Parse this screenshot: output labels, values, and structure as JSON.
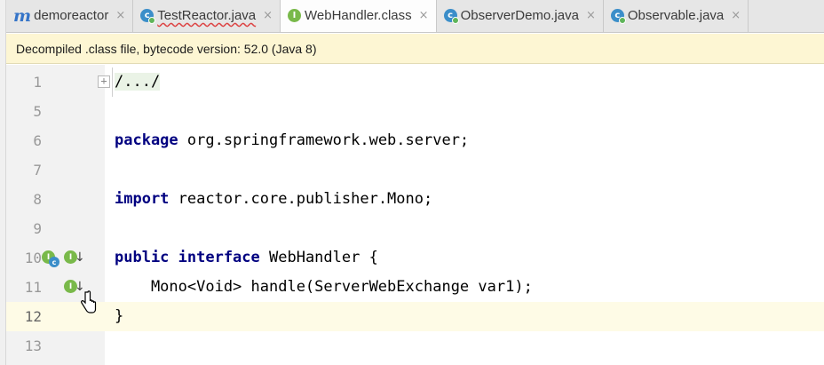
{
  "tabs": [
    {
      "label": "demoreactor",
      "icon": "module-icon",
      "active": false
    },
    {
      "label": "TestReactor.java",
      "icon": "class-icon",
      "active": false
    },
    {
      "label": "WebHandler.class",
      "icon": "interface-icon",
      "active": true
    },
    {
      "label": "ObserverDemo.java",
      "icon": "class-icon",
      "active": false
    },
    {
      "label": "Observable.java",
      "icon": "class-icon",
      "active": false
    }
  ],
  "close_glyph": "×",
  "banner": {
    "text": "Decompiled .class file, bytecode version: 52.0 (Java 8)"
  },
  "editor": {
    "lines": [
      {
        "num": "1",
        "code": "/.../"
      },
      {
        "num": "5",
        "code": ""
      },
      {
        "num": "6",
        "kw": "package",
        "rest": " org.springframework.web.server;"
      },
      {
        "num": "7",
        "code": ""
      },
      {
        "num": "8",
        "kw": "import",
        "rest": " reactor.core.publisher.Mono;"
      },
      {
        "num": "9",
        "code": ""
      },
      {
        "num": "10",
        "kw": "public interface",
        "rest": " WebHandler {"
      },
      {
        "num": "11",
        "code": "    Mono<Void> handle(ServerWebExchange var1);"
      },
      {
        "num": "12",
        "code": "}"
      },
      {
        "num": "13",
        "code": ""
      }
    ],
    "fold_glyph": "+",
    "gutter_icon_letters": {
      "implemented": "I",
      "class": "c"
    },
    "arrow_glyph": "↓"
  },
  "colors": {
    "keyword": "#000080",
    "banner_bg": "#fdf6d3",
    "current_line": "#fefbe6"
  }
}
